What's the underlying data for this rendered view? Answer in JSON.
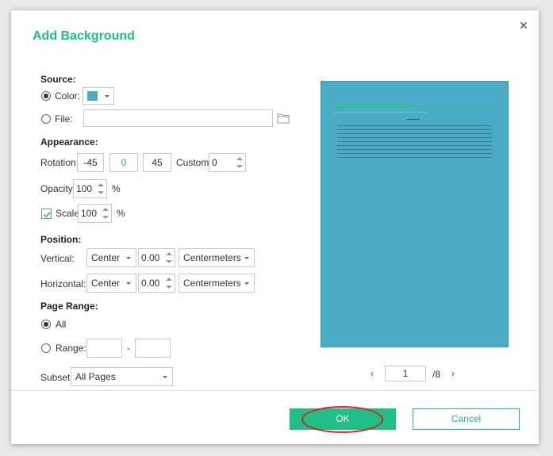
{
  "dialog": {
    "title": "Add Background",
    "close_icon": "close-icon"
  },
  "source": {
    "heading": "Source:",
    "color_label": "Color:",
    "color_value": "#4aacc6",
    "file_label": "File:",
    "file_value": "",
    "folder_icon": "folder-icon"
  },
  "appearance": {
    "heading": "Appearance:",
    "rotation_label": "Rotation:",
    "rotation_options": [
      "-45",
      "0",
      "45"
    ],
    "rotation_selected": "0",
    "custom_label": "Custom:",
    "custom_value": "0",
    "opacity_label": "Opacity:",
    "opacity_value": "100",
    "opacity_unit": "%",
    "scale_label": "Scale:",
    "scale_checked": true,
    "scale_value": "100",
    "scale_unit": "%"
  },
  "position": {
    "heading": "Position:",
    "vertical_label": "Vertical:",
    "vertical_align": "Center",
    "vertical_offset": "0.00",
    "vertical_unit": "Centermeters",
    "horizontal_label": "Horizontal:",
    "horizontal_align": "Center",
    "horizontal_offset": "0.00",
    "horizontal_unit": "Centermeters"
  },
  "page_range": {
    "heading": "Page Range:",
    "all_label": "All",
    "range_label": "Range:",
    "range_from": "",
    "range_separator": "-",
    "range_to": "",
    "subset_label": "Subset:",
    "subset_value": "All Pages"
  },
  "preview": {
    "background_color": "#4aacc6",
    "current_page": "1",
    "total_pages": "/8",
    "prev_icon": "chevron-left-icon",
    "next_icon": "chevron-right-icon"
  },
  "footer": {
    "ok_label": "OK",
    "cancel_label": "Cancel",
    "accent_color": "#1fbf86",
    "annotation_color": "#d8202a"
  }
}
